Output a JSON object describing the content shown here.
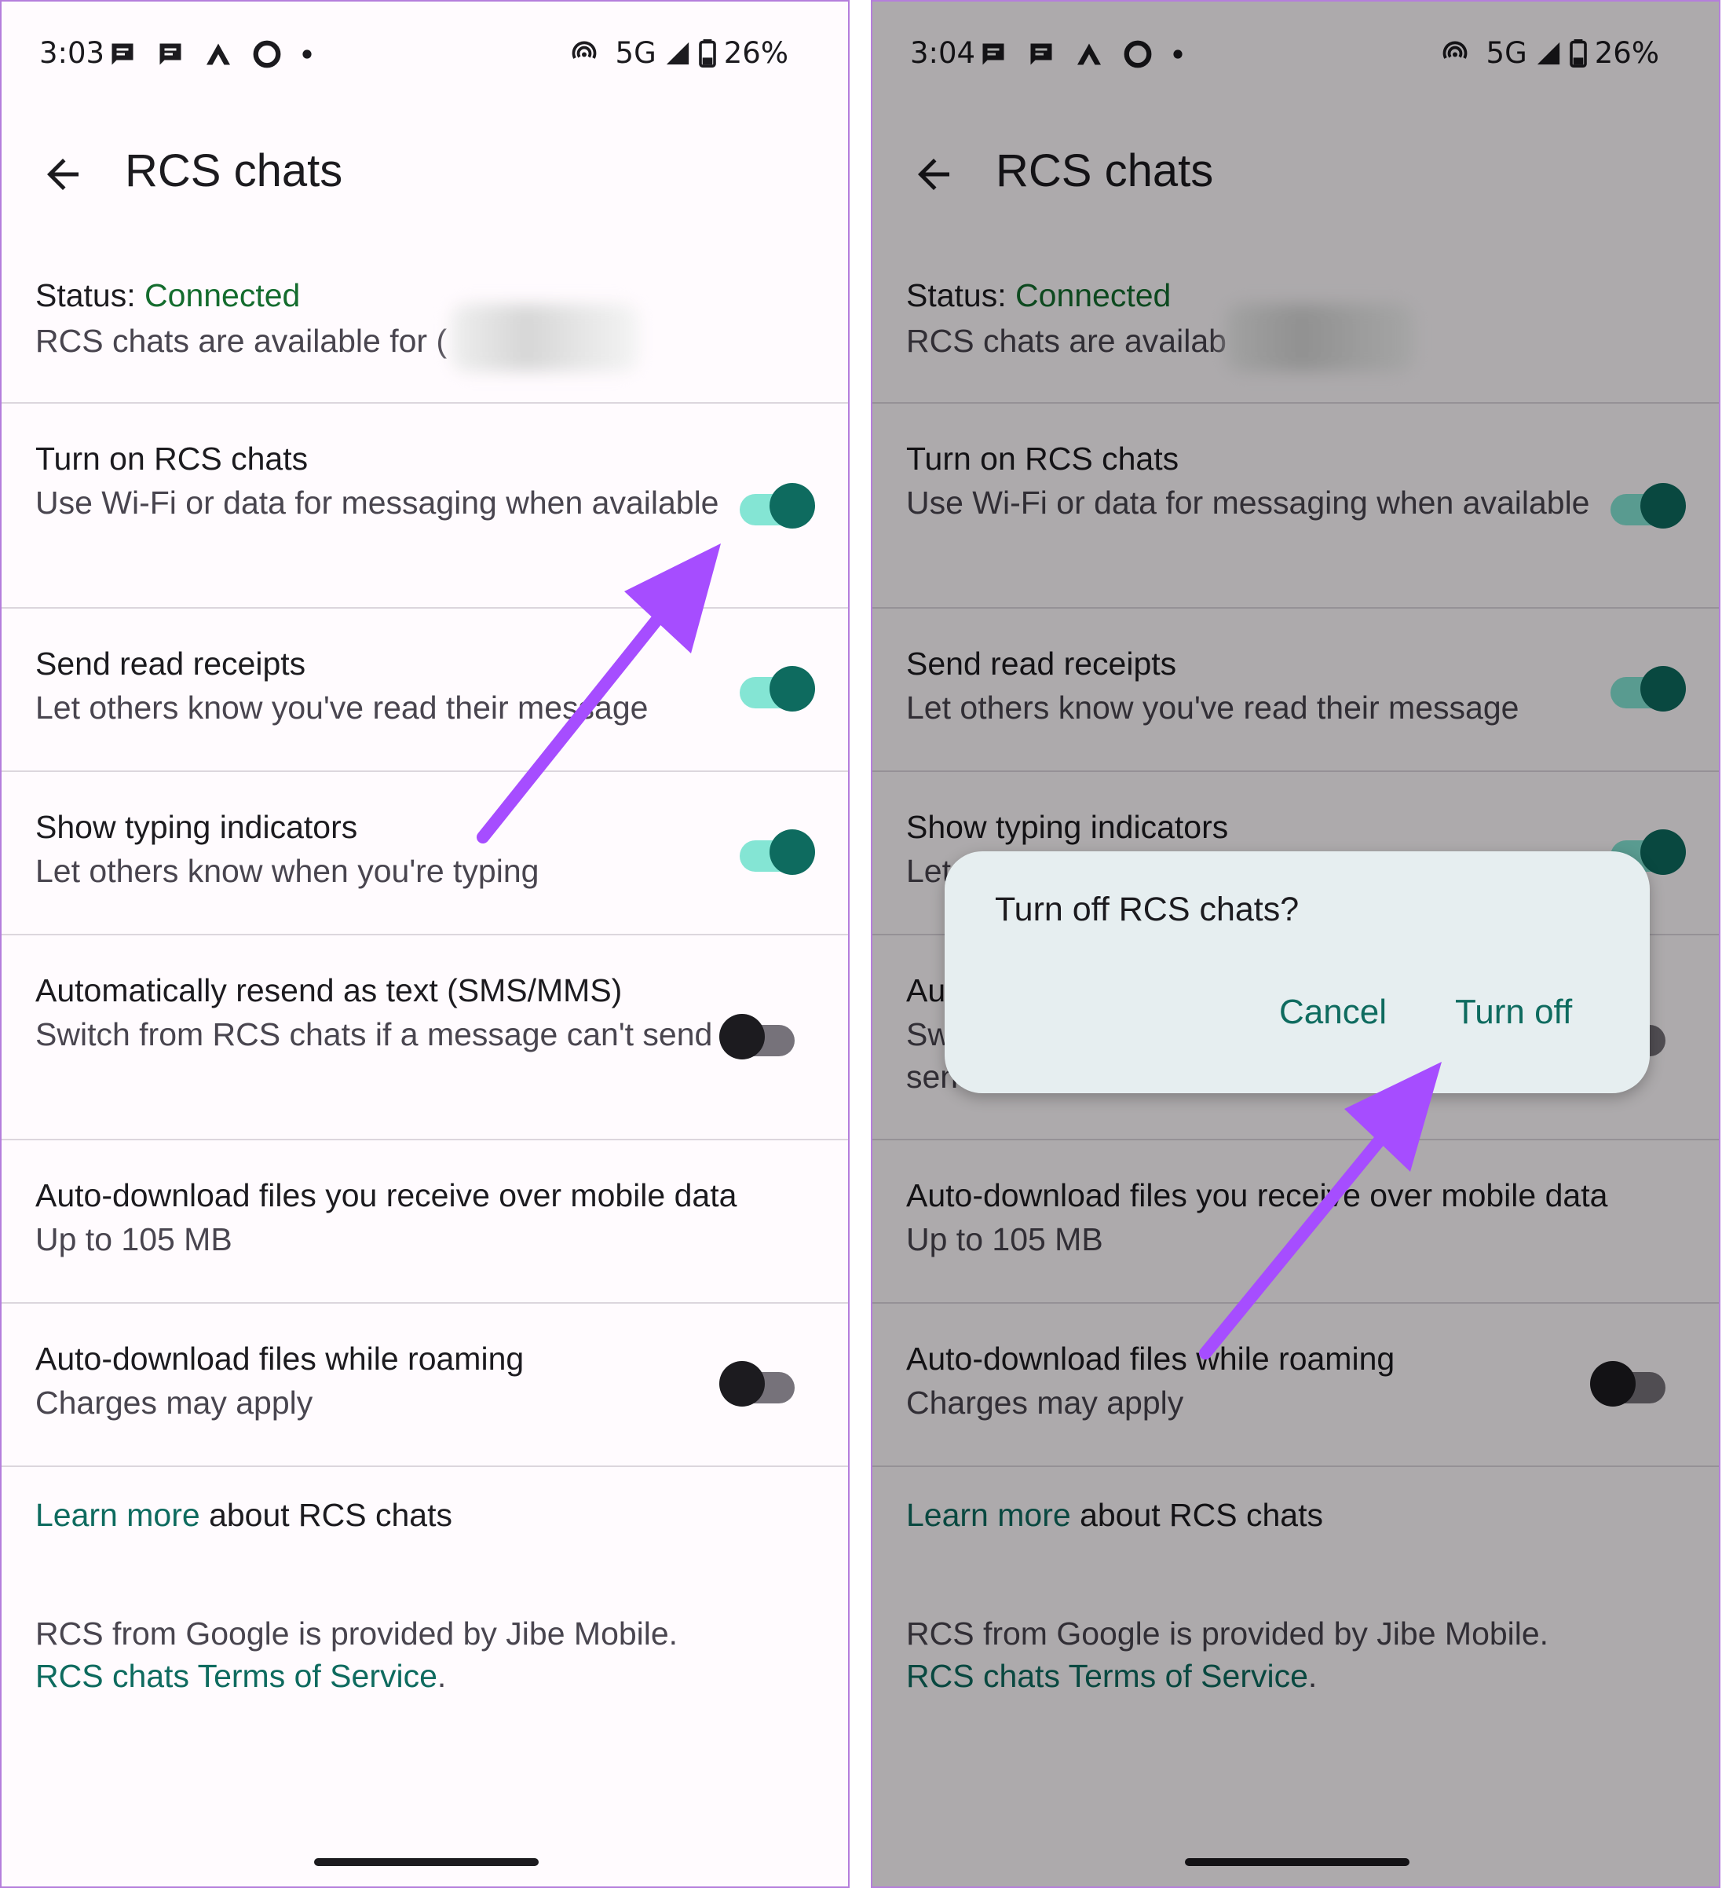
{
  "colors": {
    "accent_teal": "#0e6b5f",
    "status_connected": "#146c2e",
    "annotation_arrow": "#a64dff",
    "dialog_bg": "#e6eef0"
  },
  "screens": [
    {
      "status_bar": {
        "time": "3:03",
        "left_icons": [
          "message-icon",
          "message-icon",
          "arrow-app-icon",
          "ring-icon",
          "dot-icon"
        ],
        "network": "5G",
        "battery": "26%"
      },
      "app_bar": {
        "title": "RCS chats"
      },
      "status": {
        "label": "Status:",
        "value": "Connected",
        "description": "RCS chats are available for ("
      },
      "settings": [
        {
          "title": "Turn on RCS chats",
          "subtitle": "Use Wi-Fi or data for messaging when available",
          "toggle": true
        },
        {
          "title": "Send read receipts",
          "subtitle": "Let others know you've read their message",
          "toggle": true
        },
        {
          "title": "Show typing indicators",
          "subtitle": "Let others know when you're typing",
          "toggle": true
        },
        {
          "title": "Automatically resend as text (SMS/MMS)",
          "subtitle": "Switch from RCS chats if a message can't send",
          "toggle": false
        },
        {
          "title": "Auto-download files you receive over mobile data",
          "subtitle": "Up to 105 MB"
        },
        {
          "title": "Auto-download files while roaming",
          "subtitle": "Charges may apply",
          "toggle": false
        }
      ],
      "learn_more": {
        "link": "Learn more",
        "text": " about RCS chats"
      },
      "footer": {
        "line1": "RCS from Google is provided by Jibe Mobile.",
        "terms_link": "RCS chats Terms of Service",
        "terms_suffix": "."
      }
    },
    {
      "status_bar": {
        "time": "3:04",
        "left_icons": [
          "message-icon",
          "message-icon",
          "arrow-app-icon",
          "ring-icon",
          "dot-icon"
        ],
        "network": "5G",
        "battery": "26%"
      },
      "app_bar": {
        "title": "RCS chats"
      },
      "status": {
        "label": "Status:",
        "value": "Connected",
        "description": "RCS chats are availab"
      },
      "settings": [
        {
          "title": "Turn on RCS chats",
          "subtitle": "Use Wi-Fi or data for messaging when available",
          "toggle": true
        },
        {
          "title": "Send read receipts",
          "subtitle": "Let others know you've read their message",
          "toggle": true
        },
        {
          "title": "Show typing indicators",
          "subtitle": "Let",
          "toggle": true
        },
        {
          "title": "Au",
          "subtitle": "Sw send",
          "toggle": false
        },
        {
          "title": "Auto-download files you receive over mobile data",
          "subtitle": "Up to 105 MB"
        },
        {
          "title": "Auto-download files while roaming",
          "subtitle": "Charges may apply",
          "toggle": false
        }
      ],
      "learn_more": {
        "link": "Learn more",
        "text": " about RCS chats"
      },
      "footer": {
        "line1": "RCS from Google is provided by Jibe Mobile.",
        "terms_link": "RCS chats Terms of Service",
        "terms_suffix": "."
      },
      "dialog": {
        "title": "Turn off RCS chats?",
        "cancel": "Cancel",
        "confirm": "Turn off"
      }
    }
  ]
}
